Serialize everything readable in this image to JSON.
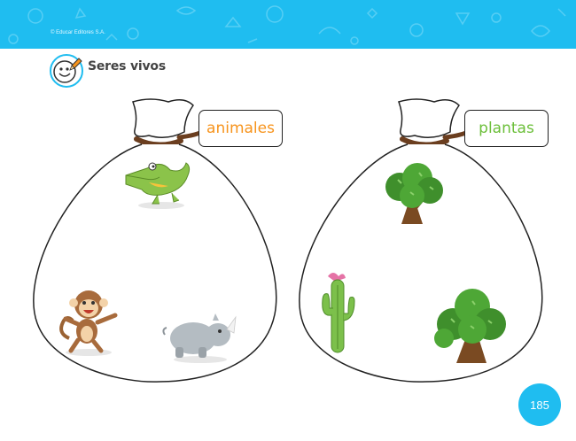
{
  "header": {
    "copyright": "© Educar Editores S.A.",
    "band_color": "#1fbdf0"
  },
  "section": {
    "title": "Seres vivos",
    "icon": "smiley-pencil-icon"
  },
  "bags": [
    {
      "label": "animales",
      "label_color": "#f7941d",
      "items": [
        "crocodile",
        "monkey",
        "rhinoceros"
      ]
    },
    {
      "label": "plantas",
      "label_color": "#6cbf3a",
      "items": [
        "tree",
        "cactus",
        "tree"
      ]
    }
  ],
  "footer": {
    "page_number": "185"
  }
}
